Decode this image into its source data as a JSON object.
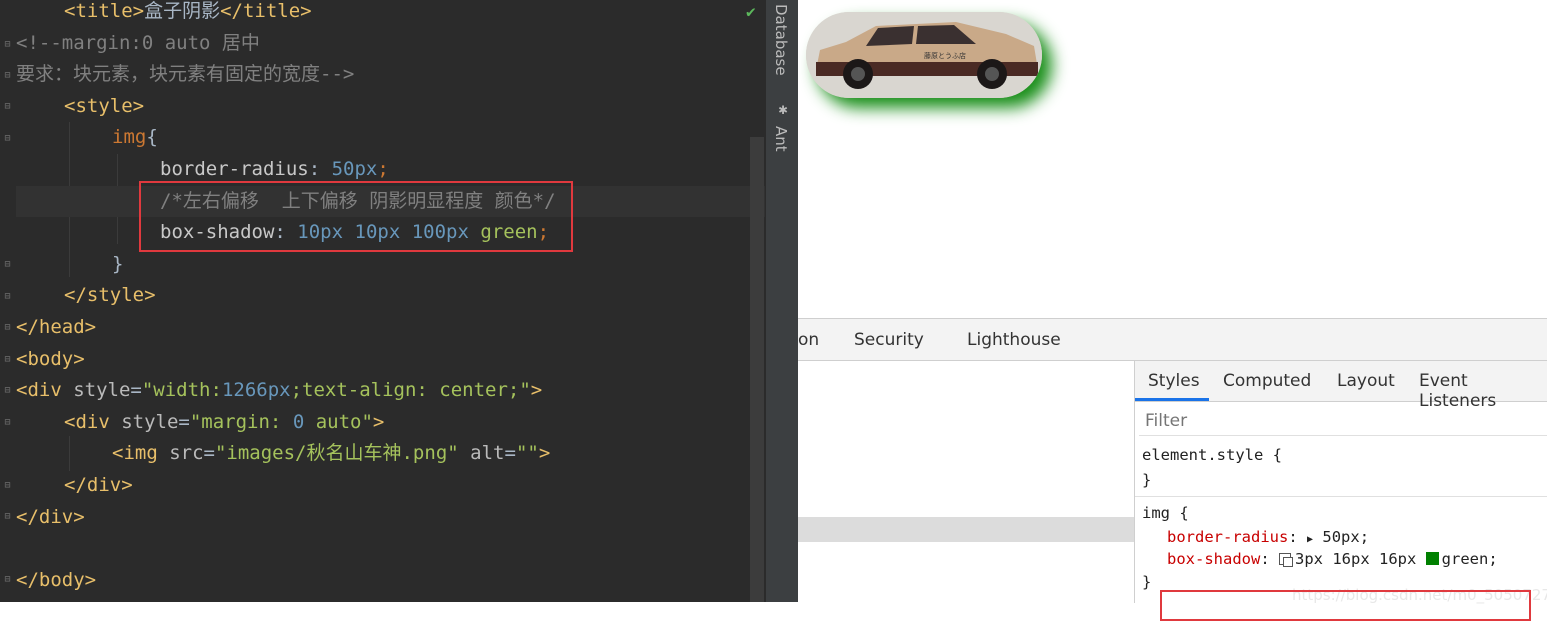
{
  "editor": {
    "lines": [
      [
        [
          "tag",
          "<title>"
        ],
        [
          "txt",
          "盒子阴影"
        ],
        [
          "tag",
          "</title>"
        ]
      ],
      [
        [
          "cmt",
          "<!--margin:0 auto 居中"
        ]
      ],
      [
        [
          "cmt",
          "要求：块元素，块元素有固定的宽度-->"
        ]
      ],
      [
        [
          "tag",
          "<style>"
        ]
      ],
      [
        [
          "sel",
          "img"
        ],
        [
          "txt",
          "{"
        ]
      ],
      [
        [
          "prop",
          "border-radius"
        ],
        [
          "txt",
          ": "
        ],
        [
          "num",
          "50px"
        ],
        [
          "punct",
          ";"
        ]
      ],
      [
        [
          "cmt",
          "/*左右偏移  上下偏移 阴影明显程度 颜色*/"
        ]
      ],
      [
        [
          "prop",
          "box-shadow"
        ],
        [
          "txt",
          ": "
        ],
        [
          "num",
          "10px"
        ],
        [
          "txt",
          " "
        ],
        [
          "num",
          "10px"
        ],
        [
          "txt",
          " "
        ],
        [
          "num",
          "100px"
        ],
        [
          "txt",
          " "
        ],
        [
          "str",
          "green"
        ],
        [
          "punct",
          ";"
        ]
      ],
      [
        [
          "txt",
          "}"
        ]
      ],
      [
        [
          "tag",
          "</style>"
        ]
      ],
      [
        [
          "tag",
          "</head>"
        ]
      ],
      [
        [
          "tag",
          "<body>"
        ]
      ],
      [
        [
          "tag",
          "<div "
        ],
        [
          "attr",
          "style"
        ],
        [
          "txt",
          "="
        ],
        [
          "str",
          "\"width:"
        ],
        [
          "num",
          "1266px"
        ],
        [
          "str",
          ";text-align: center;\""
        ],
        [
          "tag",
          ">"
        ]
      ],
      [
        [
          "tag",
          "<div "
        ],
        [
          "attr",
          "style"
        ],
        [
          "txt",
          "="
        ],
        [
          "str",
          "\"margin: "
        ],
        [
          "num",
          "0"
        ],
        [
          "str",
          " auto\""
        ],
        [
          "tag",
          ">"
        ]
      ],
      [
        [
          "tag",
          "<img "
        ],
        [
          "attr",
          "src"
        ],
        [
          "txt",
          "="
        ],
        [
          "str",
          "\"images/秋名山车神.png\""
        ],
        [
          "txt",
          " "
        ],
        [
          "attr",
          "alt"
        ],
        [
          "txt",
          "="
        ],
        [
          "str",
          "\"\""
        ],
        [
          "tag",
          ">"
        ]
      ],
      [
        [
          "tag",
          "</div>"
        ]
      ],
      [
        [
          "tag",
          "</div>"
        ]
      ],
      [],
      [
        [
          "tag",
          "</body>"
        ]
      ]
    ],
    "status_check": "✔"
  },
  "toolstrip": {
    "database_label": "Database",
    "ant_label": "Ant",
    "ant_icon": "ant-bug-icon"
  },
  "preview": {
    "car_caption": "藤原とうふ店"
  },
  "devtools": {
    "tabs": [
      "on",
      "Security",
      "Lighthouse"
    ],
    "styles_tabs": [
      "Styles",
      "Computed",
      "Layout",
      "Event Listeners"
    ],
    "filter_placeholder": "Filter",
    "element_style_open": "element.style {",
    "element_style_close": "}",
    "img_rule_open": "img {",
    "border_radius_prop": "border-radius",
    "border_radius_value": "50px;",
    "box_shadow_prop": "box-shadow",
    "box_shadow_value": "3px 16px 16px",
    "box_shadow_color": "green;",
    "img_rule_close": "}",
    "watermark": "https://blog.csdn.net/m0_5050727"
  },
  "colors": {
    "accent": "#1a73e8",
    "highlight_box": "#e0393e",
    "shadow_green": "#008000"
  }
}
